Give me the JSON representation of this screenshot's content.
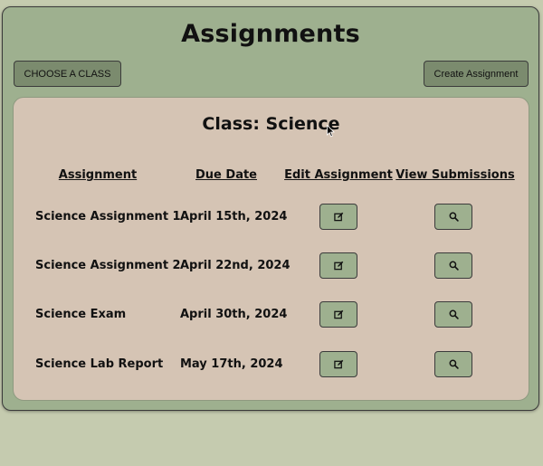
{
  "header": {
    "title": "Assignments",
    "choose_class_label": "CHOOSE A CLASS",
    "create_assignment_label": "Create Assignment"
  },
  "panel": {
    "class_title": "Class: Science",
    "columns": [
      "Assignment",
      "Due Date",
      "Edit Assignment",
      "View Submissions"
    ],
    "rows": [
      {
        "name": "Science Assignment 1",
        "due": "April 15th, 2024",
        "edit_icon": "edit-icon",
        "view_icon": "search-icon"
      },
      {
        "name": "Science Assignment 2",
        "due": "April 22nd, 2024",
        "edit_icon": "edit-icon",
        "view_icon": "search-icon"
      },
      {
        "name": "Science Exam",
        "due": "April 30th, 2024",
        "edit_icon": "edit-icon",
        "view_icon": "search-icon"
      },
      {
        "name": "Science Lab Report",
        "due": "May 17th, 2024",
        "edit_icon": "edit-icon",
        "view_icon": "search-icon"
      }
    ]
  },
  "colors": {
    "page_background": "#c5cbaf",
    "app_background": "#9eb08f",
    "panel_background": "#d5c4b4",
    "button_dark": "#7b8b6e",
    "button_light": "#9eb08f"
  }
}
